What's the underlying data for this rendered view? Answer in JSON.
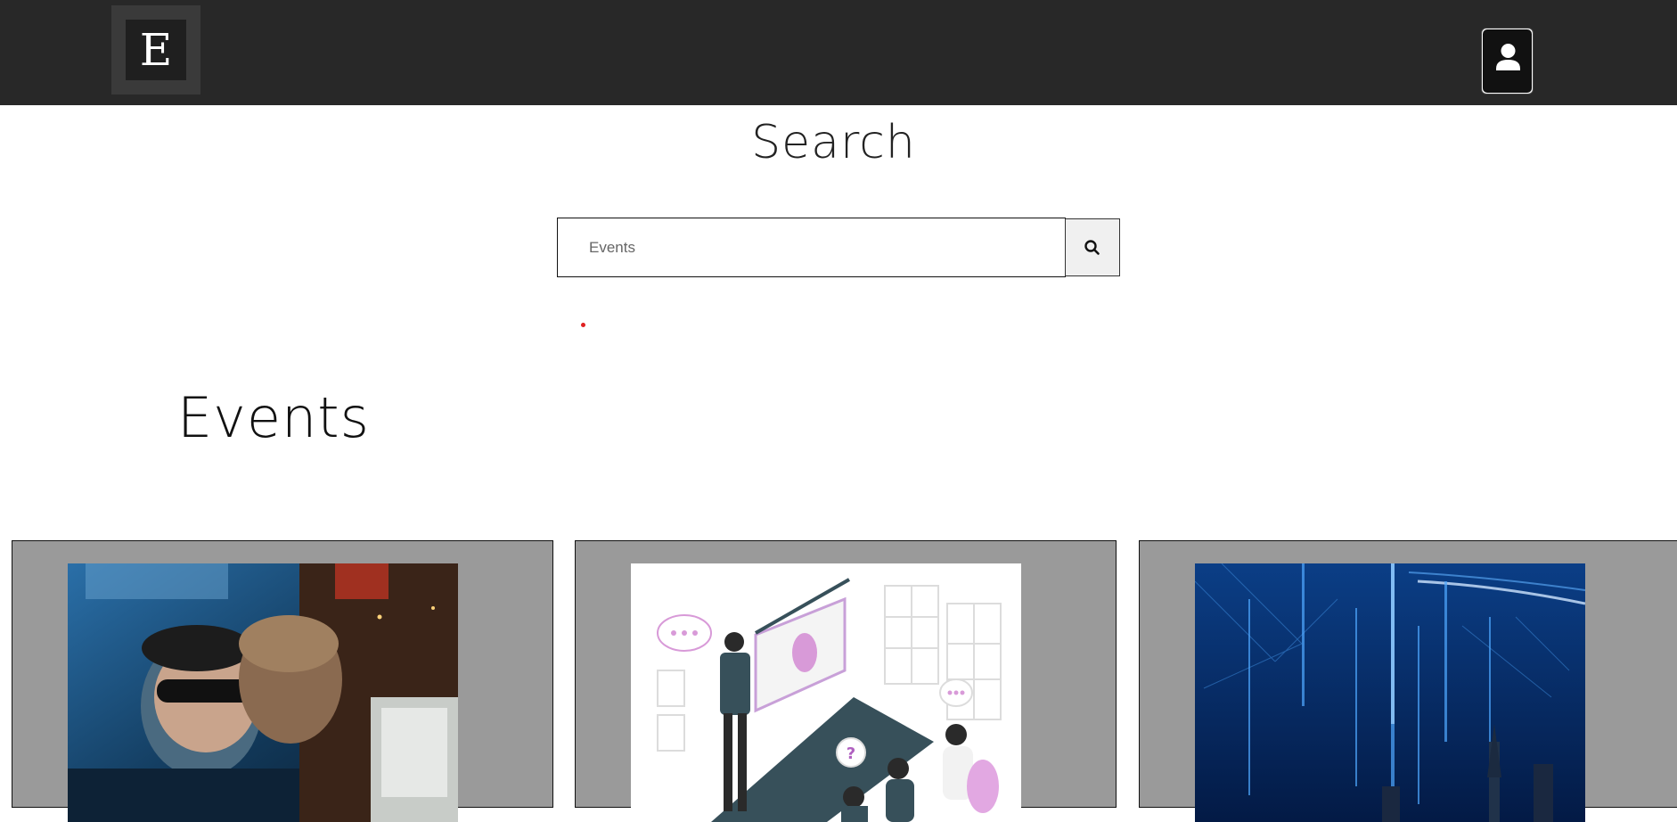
{
  "header": {
    "logo_letter": "E",
    "logo_icon": "logo-e-icon",
    "account_icon": "user-icon"
  },
  "search": {
    "title": "Search",
    "placeholder": "Events",
    "value": "",
    "button_icon": "search-icon"
  },
  "events": {
    "heading": "Events",
    "cards": [
      {
        "image": "hackers-photo"
      },
      {
        "image": "meeting-illustration"
      },
      {
        "image": "digital-city-image"
      }
    ]
  },
  "colors": {
    "topbar": "#282828",
    "card_bg": "#9a9a9a",
    "accent_dot": "#e02020"
  }
}
